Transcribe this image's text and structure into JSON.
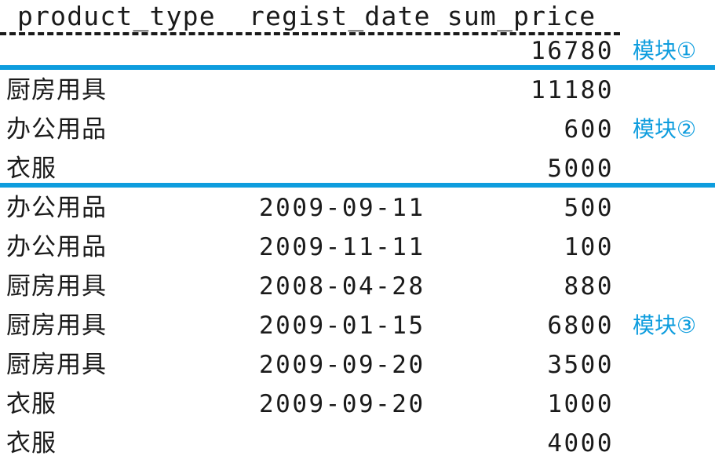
{
  "table": {
    "header_line": "product_type  regist_date sum_price",
    "columns": [
      "product_type",
      "regist_date",
      "sum_price"
    ],
    "rows": [
      {
        "product_type": "",
        "regist_date": "",
        "sum_price": "16780"
      },
      {
        "product_type": "厨房用具",
        "regist_date": "",
        "sum_price": "11180"
      },
      {
        "product_type": "办公用品",
        "regist_date": "",
        "sum_price": "600"
      },
      {
        "product_type": "衣服",
        "regist_date": "",
        "sum_price": "5000"
      },
      {
        "product_type": "办公用品",
        "regist_date": "2009-09-11",
        "sum_price": "500"
      },
      {
        "product_type": "办公用品",
        "regist_date": "2009-11-11",
        "sum_price": "100"
      },
      {
        "product_type": "厨房用具",
        "regist_date": "2008-04-28",
        "sum_price": "880"
      },
      {
        "product_type": "厨房用具",
        "regist_date": "2009-01-15",
        "sum_price": "6800"
      },
      {
        "product_type": "厨房用具",
        "regist_date": "2009-09-20",
        "sum_price": "3500"
      },
      {
        "product_type": "衣服",
        "regist_date": "2009-09-20",
        "sum_price": "1000"
      },
      {
        "product_type": "衣服",
        "regist_date": "",
        "sum_price": "4000"
      }
    ]
  },
  "annotations": {
    "module_1": "模块①",
    "module_2": "模块②",
    "module_3": "模块③"
  },
  "colors": {
    "accent_blue": "#0E9DDE",
    "text": "#1a1a1a",
    "background": "#ffffff"
  }
}
